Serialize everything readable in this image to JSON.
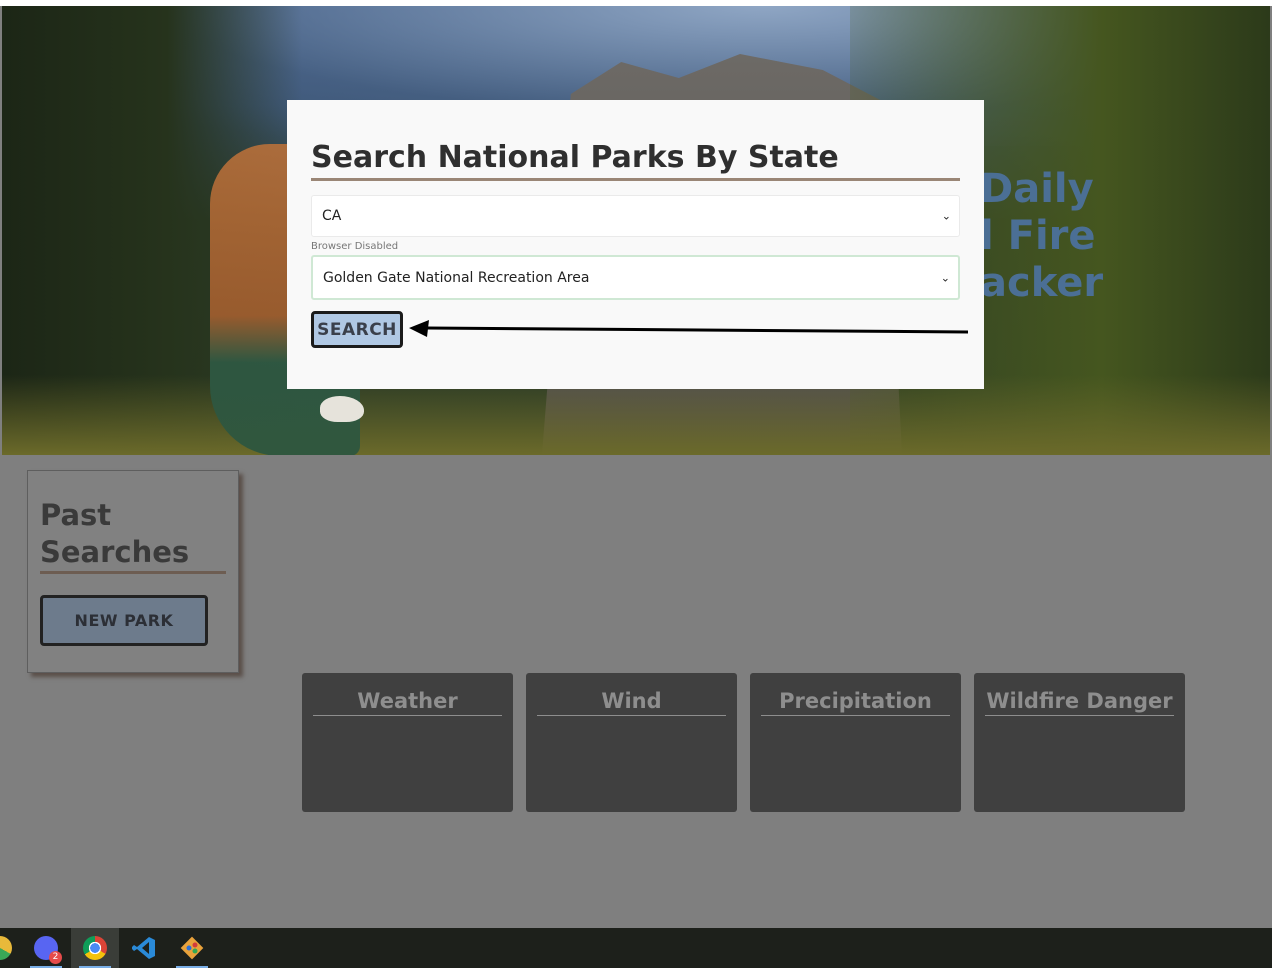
{
  "hero": {
    "title_fragment": "Daily\nl Fire\nacker"
  },
  "search_card": {
    "heading": "Search National Parks By State",
    "state_value": "CA",
    "hint": "Browser Disabled",
    "park_value": "Golden Gate National Recreation Area",
    "search_label": "SEARCH"
  },
  "past_searches": {
    "heading": "Past Searches",
    "new_park_label": "NEW PARK"
  },
  "cards": [
    {
      "title": "Weather"
    },
    {
      "title": "Wind"
    },
    {
      "title": "Precipitation"
    },
    {
      "title": "Wildfire Danger"
    }
  ],
  "taskbar": {
    "items": [
      {
        "icon": "chrome-partial-icon"
      },
      {
        "icon": "discord-icon",
        "badge": "2"
      },
      {
        "icon": "chrome-icon"
      },
      {
        "icon": "vscode-icon"
      },
      {
        "icon": "git-icon"
      }
    ]
  },
  "colors": {
    "card_bg": "#f9f9f9",
    "search_button": "#b0c8e4",
    "new_park_button": "#6d7b8c",
    "overlay": "#7f7f7f",
    "info_card": "#404040"
  }
}
